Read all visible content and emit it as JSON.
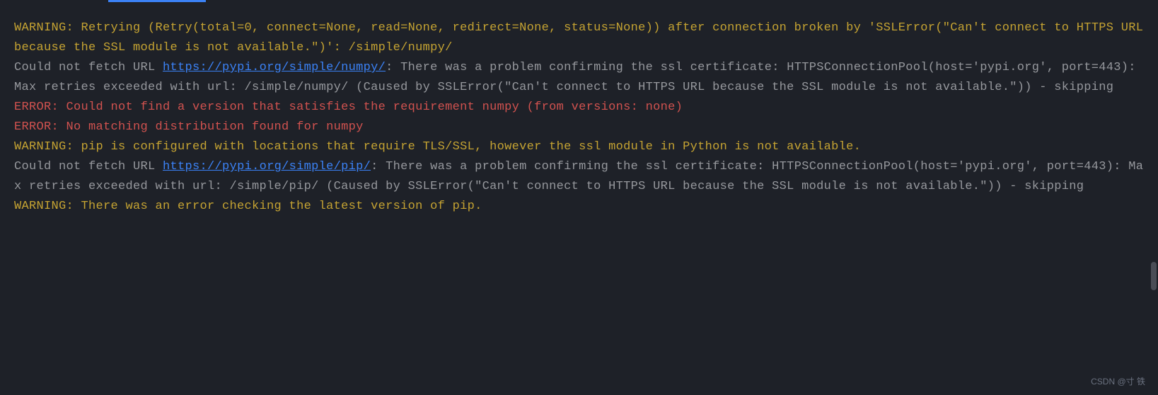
{
  "lines": [
    {
      "segments": [
        {
          "class": "warning",
          "text": "WARNING: Retrying (Retry(total=0, connect=None, read=None, redirect=None, status=None)) after connection broken by 'SSLError(\"Can't connect to HTTPS URL because the SSL module is not available.\")': /simple/numpy/"
        }
      ]
    },
    {
      "segments": [
        {
          "class": "info",
          "text": "Could not fetch URL "
        },
        {
          "class": "link",
          "text": "https://pypi.org/simple/numpy/",
          "interactable": true
        },
        {
          "class": "info",
          "text": ": There was a problem confirming the ssl certificate: HTTPSConnectionPool(host='pypi.org', port=443): Max retries exceeded with url: /simple/numpy/ (Caused by SSLError(\"Can't connect to HTTPS URL because the SSL module is not available.\")) - skipping"
        }
      ]
    },
    {
      "segments": [
        {
          "class": "error",
          "text": "ERROR: Could not find a version that satisfies the requirement numpy (from versions: none)"
        }
      ]
    },
    {
      "segments": [
        {
          "class": "error",
          "text": "ERROR: No matching distribution found for numpy"
        }
      ]
    },
    {
      "segments": [
        {
          "class": "warning",
          "text": "WARNING: pip is configured with locations that require TLS/SSL, however the ssl module in Python is not available."
        }
      ]
    },
    {
      "segments": [
        {
          "class": "info",
          "text": "Could not fetch URL "
        },
        {
          "class": "link",
          "text": "https://pypi.org/simple/pip/",
          "interactable": true
        },
        {
          "class": "info",
          "text": ": There was a problem confirming the ssl certificate: HTTPSConnectionPool(host='pypi.org', port=443): Max retries exceeded with url: /simple/pip/ (Caused by SSLError(\"Can't connect to HTTPS URL because the SSL module is not available.\")) - skipping"
        }
      ]
    },
    {
      "segments": [
        {
          "class": "warning",
          "text": "WARNING: There was an error checking the latest version of pip."
        }
      ]
    }
  ],
  "watermark": "CSDN @寸 铁"
}
